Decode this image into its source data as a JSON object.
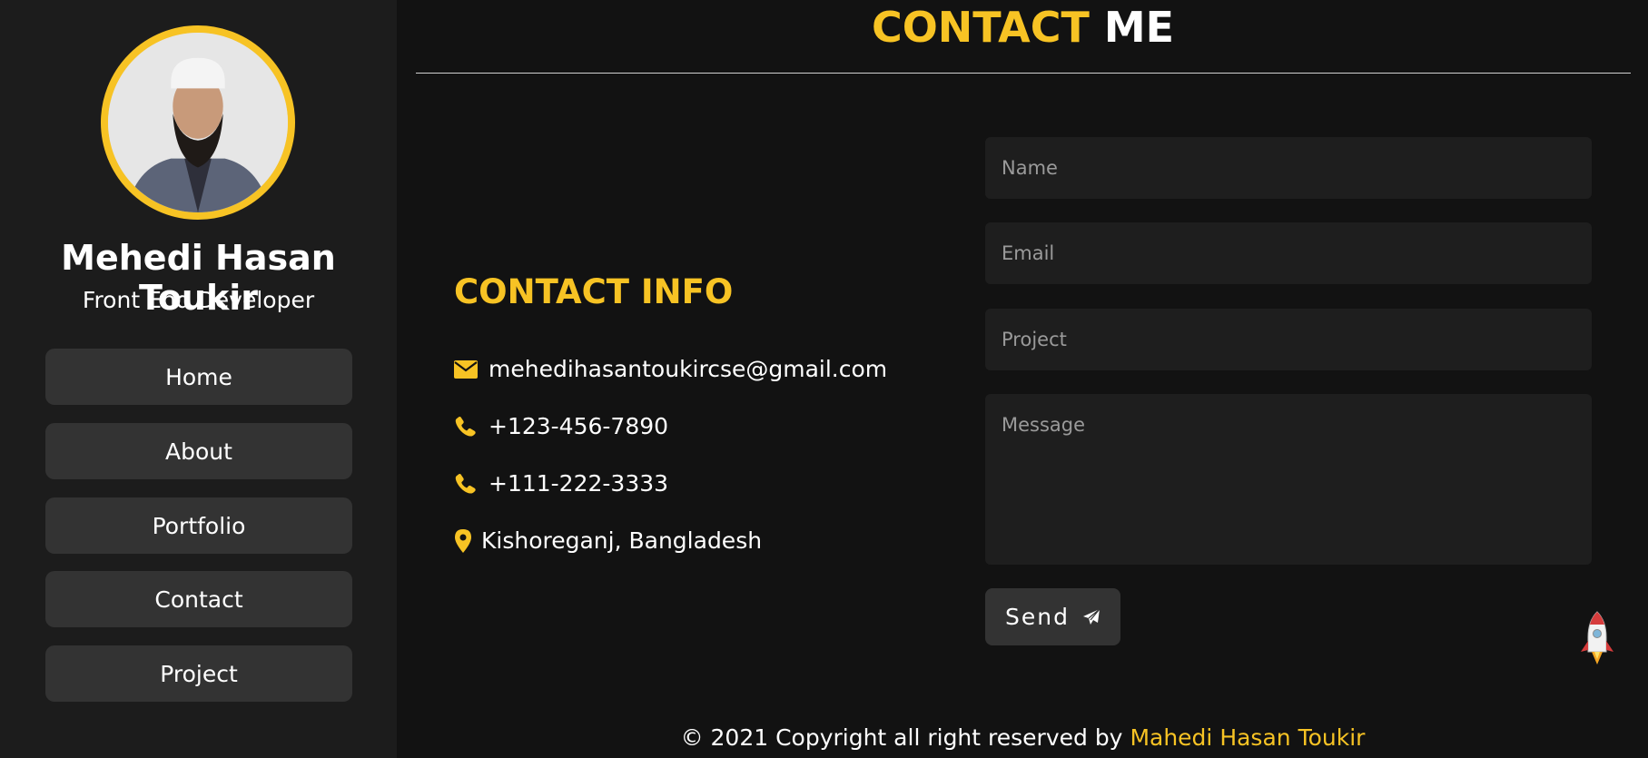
{
  "profile": {
    "name": "Mehedi Hasan Toukir",
    "role": "Front End Developer",
    "avatar_alt": "profile-photo"
  },
  "nav": {
    "items": [
      {
        "label": "Home"
      },
      {
        "label": "About"
      },
      {
        "label": "Portfolio"
      },
      {
        "label": "Contact"
      },
      {
        "label": "Project"
      }
    ]
  },
  "page": {
    "title_accent": "CONTACT",
    "title_rest": "ME"
  },
  "contact_info": {
    "heading": "CONTACT INFO",
    "email": "mehedihasantoukircse@gmail.com",
    "phone1": "+123-456-7890",
    "phone2": "+111-222-3333",
    "location": "Kishoreganj, Bangladesh",
    "icons": [
      "envelope-icon",
      "phone-icon",
      "phone-icon",
      "map-pin-icon"
    ]
  },
  "form": {
    "name_placeholder": "Name",
    "email_placeholder": "Email",
    "project_placeholder": "Project",
    "message_placeholder": "Message",
    "send_label": "Send",
    "send_icon": "paper-plane-icon"
  },
  "footer": {
    "text": "© 2021 Copyright all right reserved by",
    "author": "Mahedi Hasan Toukir"
  },
  "colors": {
    "accent": "#f7c324",
    "background": "#121212",
    "sidebar": "#1c1c1c",
    "button": "#333333"
  }
}
